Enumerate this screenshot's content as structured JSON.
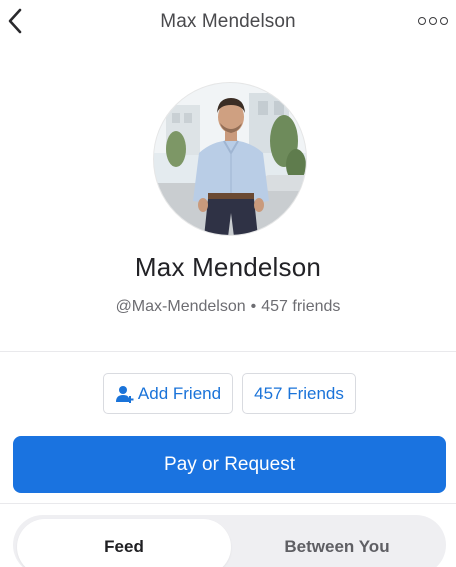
{
  "header": {
    "title": "Max Mendelson",
    "back_icon": "chevron-left-icon",
    "more_icon": "more-dots-icon"
  },
  "profile": {
    "name": "Max Mendelson",
    "username": "@Max-Mendelson",
    "separator": "•",
    "friends_count": "457 friends"
  },
  "actions": {
    "add_friend_label": "Add Friend",
    "add_friend_icon": "add-person-icon",
    "friends_label": "457 Friends",
    "pay_label": "Pay or Request"
  },
  "tabs": [
    {
      "label": "Feed",
      "selected": true
    },
    {
      "label": "Between You",
      "selected": false
    }
  ],
  "colors": {
    "accent": "#1a73e0",
    "link": "#1a73d9",
    "tab_track": "#efeff2"
  }
}
